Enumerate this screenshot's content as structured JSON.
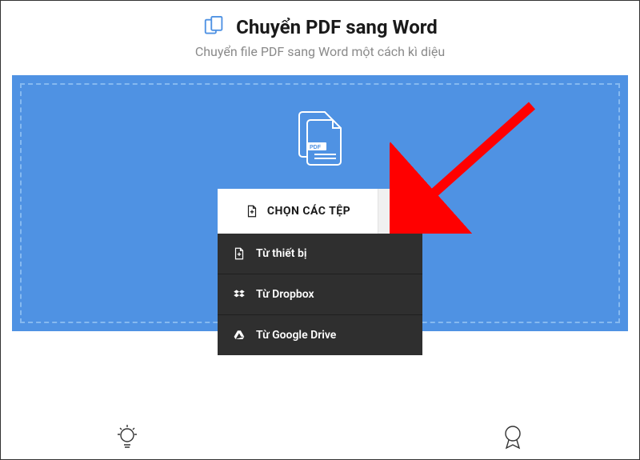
{
  "header": {
    "title": "Chuyển PDF sang Word",
    "subtitle": "Chuyển file PDF sang Word một cách kì diệu"
  },
  "choose": {
    "label": "CHỌN CÁC TỆP"
  },
  "menu": {
    "items": [
      {
        "label": "Từ thiết bị"
      },
      {
        "label": "Từ Dropbox"
      },
      {
        "label": "Từ Google Drive"
      }
    ]
  },
  "colors": {
    "dropzone": "#4f92e3",
    "arrow": "#ff0000"
  }
}
